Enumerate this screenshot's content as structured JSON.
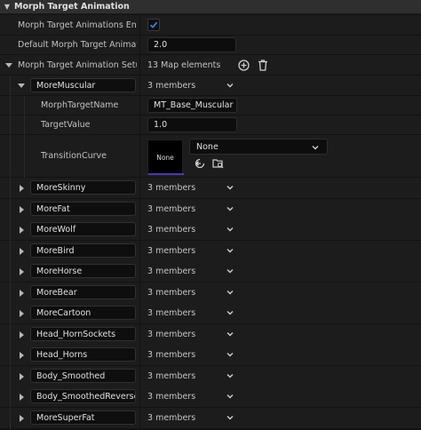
{
  "header": {
    "title": "Morph Target Animation"
  },
  "props": {
    "enabled_label": "Morph Target Animations Enabl...",
    "enabled": true,
    "default_label": "Default Morph Target Animatio...",
    "default_value": "2.0",
    "setup_label": "Morph Target Animation Setup",
    "setup_count": "13 Map elements"
  },
  "expanded": {
    "key": "MoreMuscular",
    "members": "3 members",
    "name_label": "MorphTargetName",
    "name_value": "MT_Base_Muscular",
    "target_label": "TargetValue",
    "target_value": "1.0",
    "curve_label": "TransitionCurve",
    "curve_thumb": "None",
    "curve_value": "None"
  },
  "map_items": [
    {
      "key": "MoreSkinny",
      "members": "3 members"
    },
    {
      "key": "MoreFat",
      "members": "3 members"
    },
    {
      "key": "MoreWolf",
      "members": "3 members"
    },
    {
      "key": "MoreBird",
      "members": "3 members"
    },
    {
      "key": "MoreHorse",
      "members": "3 members"
    },
    {
      "key": "MoreBear",
      "members": "3 members"
    },
    {
      "key": "MoreCartoon",
      "members": "3 members"
    },
    {
      "key": "Head_HornSockets",
      "members": "3 members"
    },
    {
      "key": "Head_Horns",
      "members": "3 members"
    },
    {
      "key": "Body_Smoothed",
      "members": "3 members"
    },
    {
      "key": "Body_SmoothedReversed",
      "members": "3 members"
    },
    {
      "key": "MoreSuperFat",
      "members": "3 members"
    }
  ]
}
